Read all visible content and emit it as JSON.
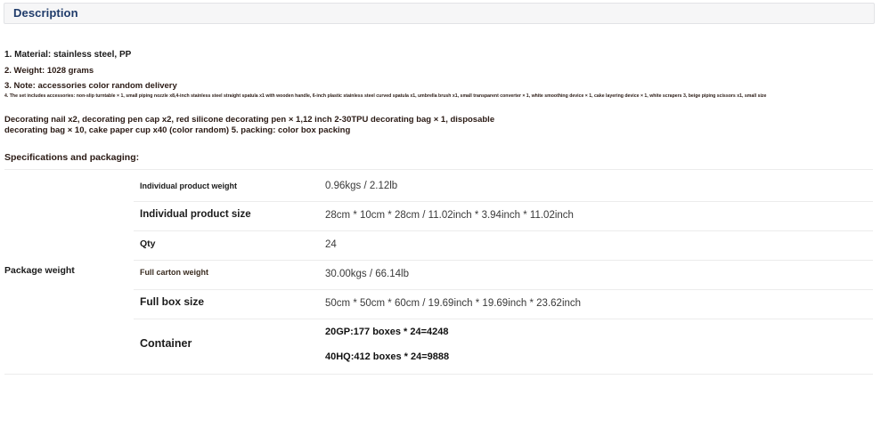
{
  "header": {
    "title": "Description"
  },
  "description": {
    "line1": "1. Material: stainless steel, PP",
    "line2": "2. Weight: 1028 grams",
    "line3": "3. Note: accessories color random delivery",
    "line4": "4. The set includes accessories: non-slip turntable × 1, small piping nozzle x8,4-inch stainless steel straight spatula x1 with wooden handle, 6-inch plastic stainless steel curved spatula x1, umbrella brush x1, small transparent converter × 1, white smoothing device × 1, cake layering device × 1, white scrapers 3, beige piping scissors x1, small size",
    "line5": "Decorating nail x2, decorating pen cap x2, red silicone decorating pen × 1,12 inch 2-30TPU decorating bag × 1, disposable decorating bag × 10, cake paper cup x40 (color random) 5. packing: color box packing"
  },
  "specs": {
    "heading": "Specifications and packaging:",
    "group_label": "Package weight",
    "rows": [
      {
        "label": "Individual product weight",
        "value": "0.96kgs / 2.12lb"
      },
      {
        "label": "Individual product size",
        "value": "28cm * 10cm * 28cm / 11.02inch * 3.94inch * 11.02inch"
      },
      {
        "label": "Qty",
        "value": "24"
      },
      {
        "label": "Full carton weight",
        "value": "30.00kgs / 66.14lb"
      },
      {
        "label": "Full box size",
        "value": "50cm * 50cm * 60cm / 19.69inch * 19.69inch * 23.62inch"
      },
      {
        "label": "Container",
        "values": [
          "20GP:177 boxes * 24=4248",
          "40HQ:412 boxes * 24=9888"
        ]
      }
    ]
  }
}
